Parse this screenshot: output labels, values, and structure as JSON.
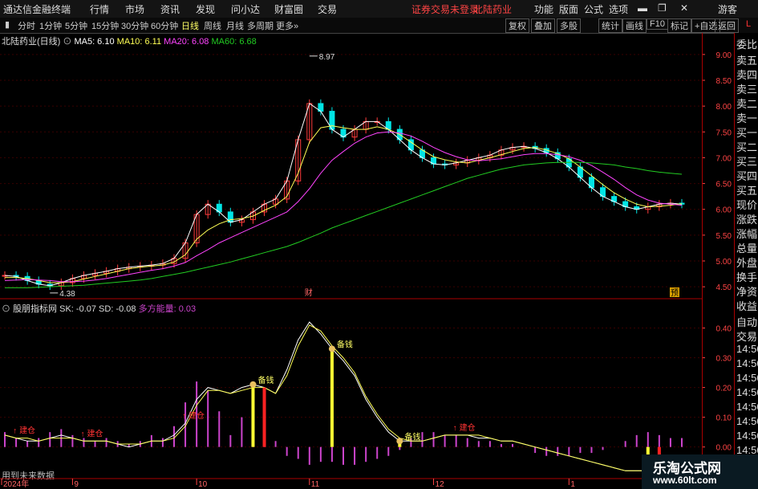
{
  "menubar": {
    "title": "通达信金融终端",
    "items": [
      "行情",
      "市场",
      "资讯",
      "发现",
      "问小达",
      "财富圈",
      "交易"
    ],
    "notice": "证券交易未登录",
    "stock_link": "北陆药业",
    "right_items": [
      "功能",
      "版面",
      "公式",
      "选项"
    ],
    "guest": "游客"
  },
  "toolbar": {
    "periods": [
      "分时",
      "1分钟",
      "5分钟",
      "15分钟",
      "30分钟",
      "60分钟",
      "日线",
      "周线",
      "月线",
      "多周期",
      "更多"
    ],
    "active_period": "日线",
    "buttons": [
      "复权",
      "叠加",
      "多股",
      "统计",
      "画线",
      "F10",
      "标记",
      "+自选",
      "返回"
    ]
  },
  "main_chart": {
    "stock": "北陆药业(日线)",
    "ma5": "MA5: 6.10",
    "ma10": "MA10: 6.11",
    "ma20": "MA20: 6.08",
    "ma60": "MA60: 6.68",
    "high_label": "8.97",
    "low_label": "4.38",
    "marker_cai": "财",
    "marker_yu": "预"
  },
  "sub_chart": {
    "name": "股朋指标网",
    "sk": "SK: -0.07",
    "sd": "SD: -0.08",
    "energy": "多方能量: 0.03",
    "footer": "用到未来数据",
    "tags": {
      "buy": "建仓",
      "sell": "备钱"
    }
  },
  "colors": {
    "up": "#ff3b3b",
    "down": "#00e5e5",
    "ma5": "#ffffff",
    "ma10": "#ffff55",
    "ma20": "#ff44ff",
    "ma60": "#22cc22",
    "energy": "#cc44cc"
  },
  "chart_data": [
    {
      "type": "candlestick",
      "ylim": [
        4.3,
        9.2
      ],
      "yticks": [
        "9.00",
        "8.50",
        "8.00",
        "7.50",
        "7.00",
        "6.50",
        "6.00",
        "5.50",
        "5.00",
        "4.50"
      ],
      "x_ticks": [
        "2024年",
        "9",
        "10",
        "11",
        "12",
        "1"
      ],
      "series": [
        {
          "name": "MA5",
          "values": [
            4.72,
            4.7,
            4.62,
            4.55,
            4.52,
            4.58,
            4.66,
            4.72,
            4.76,
            4.8,
            4.85,
            4.88,
            4.9,
            4.92,
            4.95,
            5.05,
            5.35,
            5.9,
            6.1,
            5.95,
            5.75,
            5.8,
            5.95,
            6.1,
            6.2,
            6.55,
            7.35,
            8.05,
            7.9,
            7.55,
            7.4,
            7.55,
            7.7,
            7.7,
            7.55,
            7.35,
            7.15,
            7.0,
            6.88,
            6.86,
            6.9,
            6.95,
            7.0,
            7.05,
            7.15,
            7.2,
            7.22,
            7.18,
            7.1,
            6.98,
            6.82,
            6.62,
            6.42,
            6.25,
            6.15,
            6.05,
            6.0,
            6.05,
            6.1,
            6.12,
            6.1
          ]
        },
        {
          "name": "MA10",
          "values": [
            4.68,
            4.68,
            4.66,
            4.62,
            4.58,
            4.58,
            4.6,
            4.65,
            4.7,
            4.75,
            4.8,
            4.85,
            4.88,
            4.9,
            4.92,
            4.98,
            5.12,
            5.42,
            5.6,
            5.72,
            5.8,
            5.82,
            5.87,
            5.98,
            6.08,
            6.25,
            6.7,
            7.3,
            7.58,
            7.62,
            7.58,
            7.55,
            7.55,
            7.6,
            7.55,
            7.45,
            7.3,
            7.15,
            7.02,
            6.96,
            6.92,
            6.9,
            6.95,
            7.0,
            7.06,
            7.12,
            7.18,
            7.2,
            7.15,
            7.08,
            6.98,
            6.82,
            6.65,
            6.48,
            6.32,
            6.2,
            6.1,
            6.05,
            6.06,
            6.08,
            6.11
          ]
        },
        {
          "name": "MA20",
          "values": [
            4.62,
            4.63,
            4.64,
            4.63,
            4.62,
            4.6,
            4.6,
            4.61,
            4.63,
            4.66,
            4.7,
            4.74,
            4.78,
            4.82,
            4.85,
            4.9,
            4.97,
            5.1,
            5.22,
            5.35,
            5.45,
            5.55,
            5.65,
            5.75,
            5.85,
            5.95,
            6.15,
            6.4,
            6.7,
            6.95,
            7.12,
            7.28,
            7.4,
            7.48,
            7.5,
            7.48,
            7.42,
            7.32,
            7.2,
            7.1,
            7.02,
            6.96,
            6.94,
            6.96,
            6.98,
            7.02,
            7.06,
            7.08,
            7.08,
            7.06,
            7.02,
            6.95,
            6.85,
            6.72,
            6.58,
            6.42,
            6.28,
            6.18,
            6.12,
            6.1,
            6.08
          ]
        },
        {
          "name": "MA60",
          "values": [
            4.48,
            4.48,
            4.48,
            4.49,
            4.5,
            4.51,
            4.52,
            4.53,
            4.55,
            4.57,
            4.59,
            4.61,
            4.63,
            4.66,
            4.7,
            4.74,
            4.78,
            4.83,
            4.88,
            4.93,
            4.98,
            5.04,
            5.1,
            5.16,
            5.22,
            5.28,
            5.36,
            5.45,
            5.54,
            5.64,
            5.72,
            5.8,
            5.88,
            5.96,
            6.04,
            6.12,
            6.2,
            6.28,
            6.36,
            6.44,
            6.52,
            6.6,
            6.66,
            6.72,
            6.78,
            6.82,
            6.86,
            6.88,
            6.9,
            6.91,
            6.91,
            6.91,
            6.9,
            6.88,
            6.86,
            6.82,
            6.79,
            6.75,
            6.72,
            6.7,
            6.68
          ]
        }
      ]
    },
    {
      "type": "line",
      "ylim": [
        -0.09,
        0.45
      ],
      "yticks": [
        "0.40",
        "0.30",
        "0.20",
        "0.10",
        "0.00"
      ],
      "series": [
        {
          "name": "SK",
          "values": [
            0.04,
            0.03,
            0.02,
            0.02,
            0.03,
            0.04,
            0.03,
            0.02,
            0.02,
            0.02,
            0.01,
            0.0,
            0.01,
            0.02,
            0.02,
            0.04,
            0.08,
            0.16,
            0.2,
            0.19,
            0.18,
            0.2,
            0.21,
            0.2,
            0.18,
            0.26,
            0.36,
            0.42,
            0.38,
            0.33,
            0.29,
            0.24,
            0.16,
            0.1,
            0.05,
            0.02,
            0.02,
            0.02,
            0.03,
            0.04,
            0.04,
            0.04,
            0.03,
            0.03,
            0.02,
            0.02,
            0.01,
            0.0,
            -0.01,
            -0.02,
            -0.03,
            -0.04,
            -0.05,
            -0.06,
            -0.07,
            -0.08,
            -0.08,
            -0.08,
            -0.07,
            -0.07,
            -0.07
          ]
        },
        {
          "name": "SD",
          "values": [
            0.04,
            0.03,
            0.03,
            0.02,
            0.03,
            0.03,
            0.03,
            0.02,
            0.02,
            0.02,
            0.01,
            0.01,
            0.01,
            0.02,
            0.02,
            0.03,
            0.07,
            0.14,
            0.19,
            0.19,
            0.18,
            0.19,
            0.2,
            0.2,
            0.18,
            0.24,
            0.34,
            0.41,
            0.39,
            0.34,
            0.3,
            0.25,
            0.17,
            0.11,
            0.06,
            0.03,
            0.02,
            0.02,
            0.03,
            0.04,
            0.04,
            0.04,
            0.04,
            0.03,
            0.02,
            0.02,
            0.01,
            0.0,
            -0.01,
            -0.02,
            -0.03,
            -0.04,
            -0.05,
            -0.06,
            -0.07,
            -0.08,
            -0.08,
            -0.08,
            -0.08,
            -0.08,
            -0.08
          ]
        },
        {
          "name": "多方能量",
          "values": [
            0.05,
            0.03,
            0.02,
            0.03,
            0.05,
            0.06,
            0.04,
            0.03,
            0.02,
            0.03,
            0.02,
            0.01,
            0.02,
            0.04,
            0.03,
            0.07,
            0.15,
            0.22,
            0.19,
            0.12,
            0.04,
            0.1,
            0.21,
            0.12,
            0.02,
            -0.03,
            -0.04,
            -0.06,
            -0.05,
            -0.05,
            -0.06,
            -0.06,
            -0.05,
            -0.04,
            -0.03,
            -0.01,
            0.03,
            0.05,
            0.05,
            0.04,
            0.04,
            0.03,
            0.02,
            0.02,
            0.01,
            0.01,
            0.0,
            -0.02,
            -0.03,
            -0.03,
            -0.03,
            -0.02,
            -0.02,
            -0.01,
            0.0,
            0.02,
            0.04,
            0.05,
            0.04,
            0.03,
            0.03
          ]
        }
      ]
    }
  ]
}
